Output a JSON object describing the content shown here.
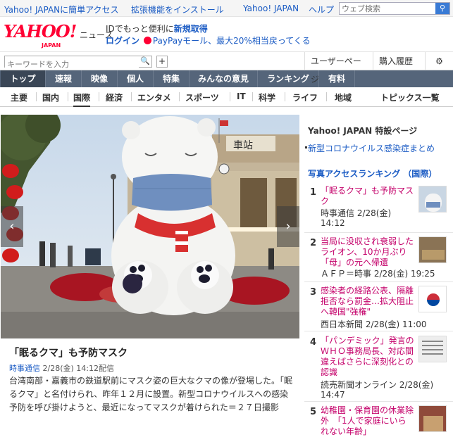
{
  "topbar": {
    "link1": "Yahoo! JAPANに簡単アクセス",
    "link2": "拡張機能をインストール",
    "link3": "Yahoo! JAPAN",
    "link4": "ヘルプ",
    "search_placeholder": "ウェブ検索",
    "search_icon": "search-icon"
  },
  "header": {
    "logo_text": "YAHOO!",
    "logo_sub": "JAPAN",
    "news_label": "ニュース",
    "promo1_prefix": "IDでもっと便利に",
    "promo1_bold": "新規取得",
    "promo2_login": "ログイン",
    "promo2_text": "PayPayモール、最大20%相当戻ってくる"
  },
  "toolbar": {
    "keyword_placeholder": "キーワードを入力",
    "plus": "+",
    "user_page": "ユーザーページ",
    "purchase_history": "購入履歴",
    "settings_icon": "gear-icon"
  },
  "nav": {
    "items": [
      "トップ",
      "速報",
      "映像",
      "個人",
      "特集",
      "みんなの意見",
      "ランキング",
      "有料"
    ]
  },
  "subnav": {
    "items": [
      "主要",
      "国内",
      "国際",
      "経済",
      "エンタメ",
      "スポーツ",
      "IT",
      "科学",
      "ライフ",
      "地域"
    ],
    "topics": "トピックス一覧",
    "active": "国際"
  },
  "article": {
    "title": "「眠るクマ」も予防マスク",
    "source": "時事通信",
    "date": "2/28(金) 14:12配信",
    "body": "台湾南部・嘉義市の鉄道駅前にマスク姿の巨大なクマの像が登場した。「眠るクマ」と名付けられ、昨年１２月に設置。新型コロナウイルスへの感染予防を呼び掛けようと、最近になってマスクが着けられた＝２７日撮影",
    "station_sign": "車站",
    "prev_icon": "chevron-left-icon",
    "next_icon": "chevron-right-icon"
  },
  "sidebar": {
    "special_heading": "Yahoo! JAPAN 特設ページ",
    "special_link": "新型コロナウイルス感染症まとめ",
    "ranking_heading": "写真アクセスランキング （国際）",
    "ranking": [
      {
        "rank": "1",
        "title": "「眠るクマ」も予防マスク",
        "source": "時事通信 2/28(金)",
        "time": "14:12"
      },
      {
        "rank": "2",
        "title": "当局に没収され衰弱したライオン、10か月ぶり「母」の元へ帰還",
        "source": "ＡＦＰ＝時事 2/28(金) 19:25",
        "time": ""
      },
      {
        "rank": "3",
        "title": "感染者の経路公表、隔離拒否なら罰金…拡大阻止へ韓国\"強権\"",
        "source": "西日本新聞 2/28(金) 11:00",
        "time": ""
      },
      {
        "rank": "4",
        "title": "「パンデミック」発言のＷＨＯ事務局長、対応間違えばさらに深刻化との認識",
        "source": "読売新聞オンライン 2/28(金)",
        "time": "14:47"
      },
      {
        "rank": "5",
        "title": "幼稚園・保育園の休業除外　「1人で家庭にいられない年齢」",
        "source": "",
        "time": ""
      }
    ]
  },
  "colors": {
    "nav_bg": "#55657a",
    "ranking_title": "#c4006a",
    "link": "#1a5bc4",
    "logo": "#ff0033"
  }
}
